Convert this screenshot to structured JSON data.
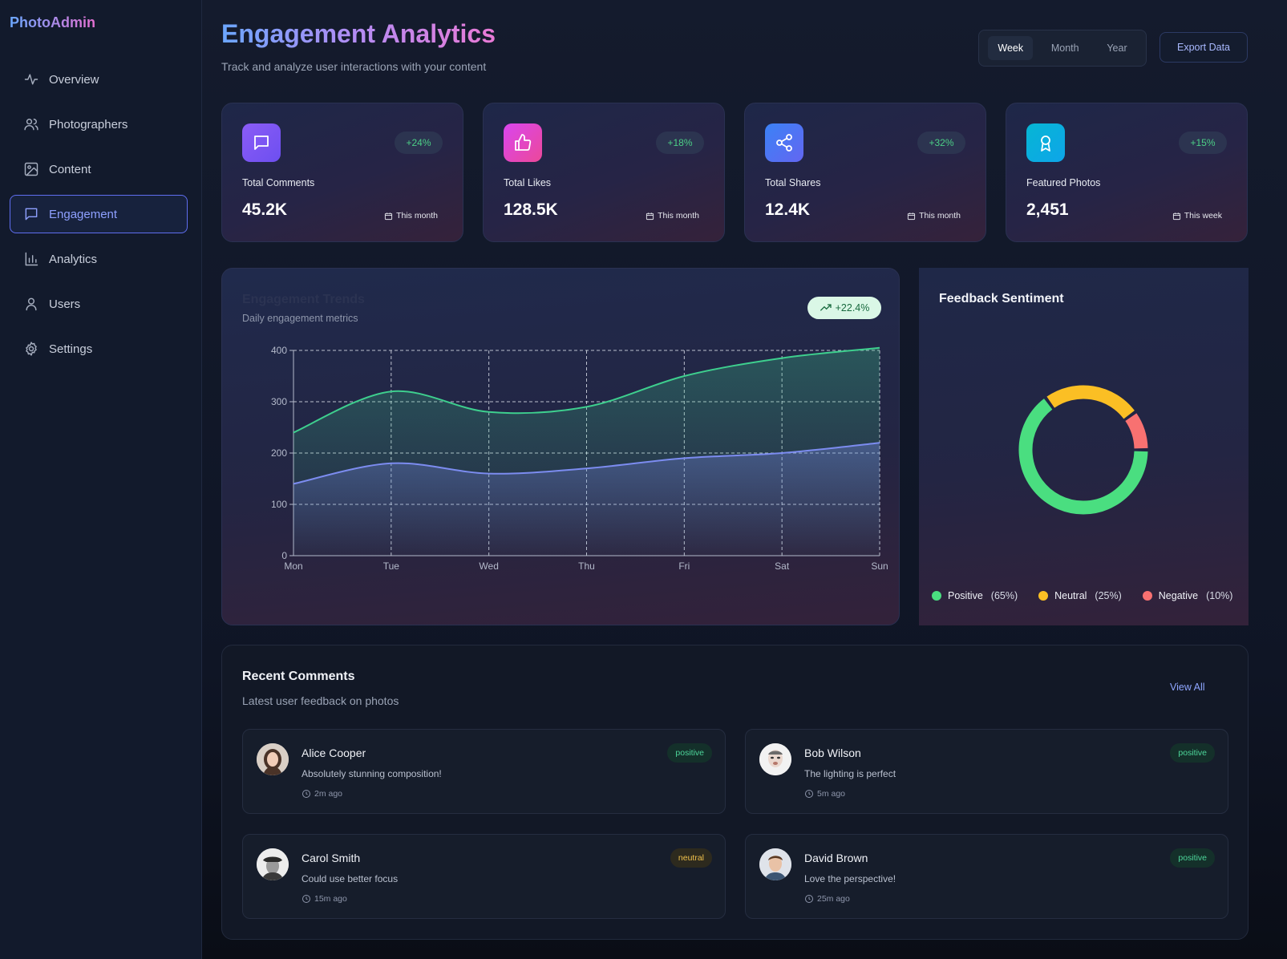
{
  "brand": "PhotoAdmin",
  "nav": [
    {
      "label": "Overview",
      "icon": "activity-icon"
    },
    {
      "label": "Photographers",
      "icon": "users-icon"
    },
    {
      "label": "Content",
      "icon": "image-icon"
    },
    {
      "label": "Engagement",
      "icon": "message-icon",
      "active": true
    },
    {
      "label": "Analytics",
      "icon": "bar-chart-icon"
    },
    {
      "label": "Users",
      "icon": "user-icon"
    },
    {
      "label": "Settings",
      "icon": "gear-icon"
    }
  ],
  "header": {
    "title": "Engagement Analytics",
    "subtitle": "Track and analyze user interactions with your content",
    "range_options": [
      "Week",
      "Month",
      "Year"
    ],
    "range_selected": "Week",
    "export_label": "Export Data"
  },
  "stats": [
    {
      "label": "Total Comments",
      "value": "45.2K",
      "change": "+24%",
      "period": "This month",
      "icon": "message-icon",
      "color_from": "#8b5cf6",
      "color_to": "#6d4ff0"
    },
    {
      "label": "Total Likes",
      "value": "128.5K",
      "change": "+18%",
      "period": "This month",
      "icon": "thumbs-up-icon",
      "color_from": "#d946ef",
      "color_to": "#ec4899"
    },
    {
      "label": "Total Shares",
      "value": "12.4K",
      "change": "+32%",
      "period": "This month",
      "icon": "share-icon",
      "color_from": "#3b82f6",
      "color_to": "#6366f1"
    },
    {
      "label": "Featured Photos",
      "value": "2,451",
      "change": "+15%",
      "period": "This week",
      "icon": "award-icon",
      "color_from": "#06b6d4",
      "color_to": "#0ea5e9"
    }
  ],
  "trend": {
    "title": "Engagement Trends",
    "subtitle": "Daily engagement metrics",
    "badge": "+22.4%"
  },
  "chart_data": [
    {
      "type": "area",
      "categories": [
        "Mon",
        "Tue",
        "Wed",
        "Thu",
        "Fri",
        "Sat",
        "Sun"
      ],
      "series": [
        {
          "values": [
            240,
            320,
            280,
            290,
            350,
            385,
            405
          ],
          "color": "#3ecf8e"
        },
        {
          "values": [
            140,
            180,
            160,
            170,
            190,
            200,
            220
          ],
          "color": "#7c8cf0"
        }
      ],
      "ylim": [
        0,
        400
      ],
      "yticks": [
        0,
        100,
        200,
        300,
        400
      ],
      "grid": true
    },
    {
      "type": "pie",
      "title": "Feedback Sentiment",
      "slices": [
        {
          "name": "Positive",
          "value": 65,
          "label": "(65%)",
          "color": "#4ade80"
        },
        {
          "name": "Neutral",
          "value": 25,
          "label": "(25%)",
          "color": "#fbbf24"
        },
        {
          "name": "Negative",
          "value": 10,
          "label": "(10%)",
          "color": "#f87171"
        }
      ]
    }
  ],
  "comments": {
    "title": "Recent Comments",
    "subtitle": "Latest user feedback on photos",
    "view_all": "View All",
    "items": [
      {
        "name": "Alice Cooper",
        "text": "Absolutely stunning composition!",
        "time": "2m ago",
        "sentiment": "positive"
      },
      {
        "name": "Bob Wilson",
        "text": "The lighting is perfect",
        "time": "5m ago",
        "sentiment": "positive"
      },
      {
        "name": "Carol Smith",
        "text": "Could use better focus",
        "time": "15m ago",
        "sentiment": "neutral"
      },
      {
        "name": "David Brown",
        "text": "Love the perspective!",
        "time": "25m ago",
        "sentiment": "positive"
      }
    ]
  }
}
